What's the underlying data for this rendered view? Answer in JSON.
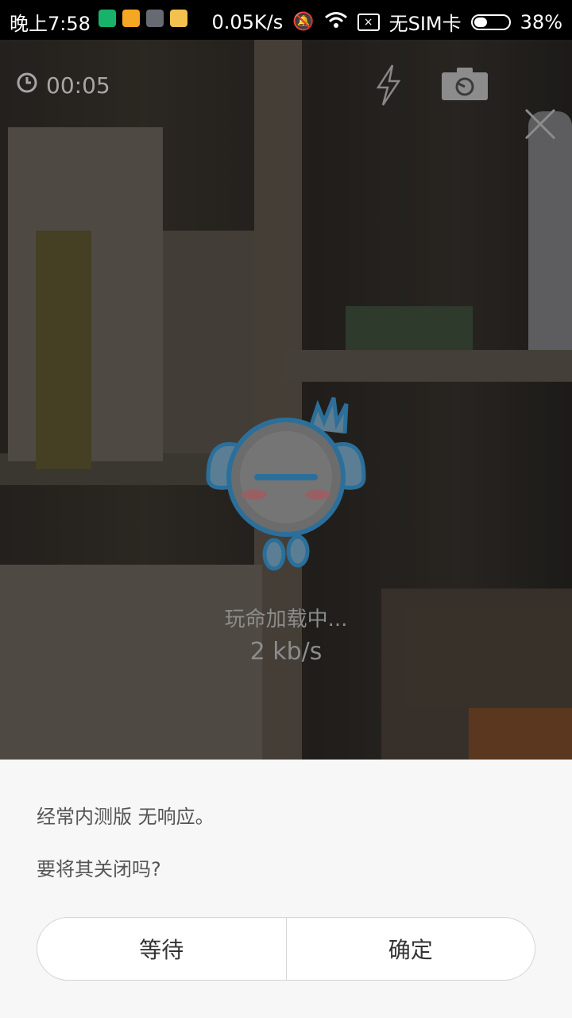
{
  "status_bar": {
    "time": "晚上7:58",
    "net_speed": "0.05K/s",
    "sim": "无SIM卡",
    "battery": "38%",
    "battery_level": 0.38
  },
  "camera": {
    "timer": "00:05"
  },
  "loading": {
    "text": "玩命加载中...",
    "speed": "2 kb/s"
  },
  "dialog": {
    "message": "经常内测版 无响应。",
    "question": "要将其关闭吗?",
    "wait_label": "等待",
    "ok_label": "确定"
  }
}
